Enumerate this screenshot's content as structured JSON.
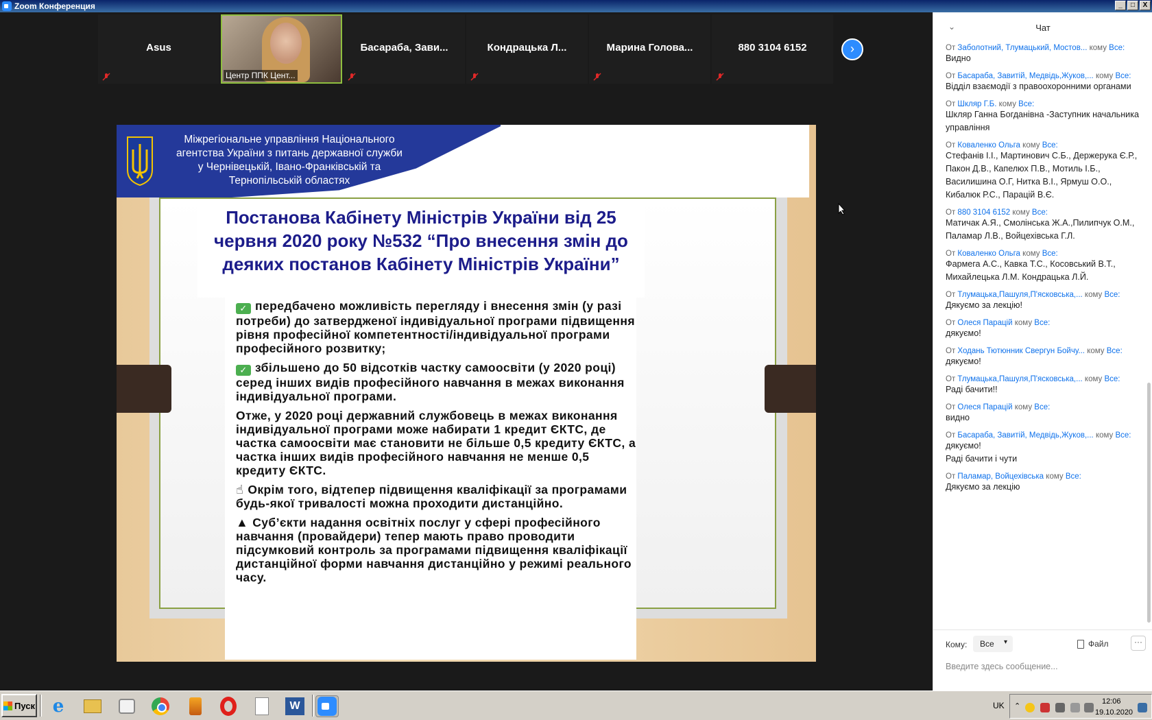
{
  "window": {
    "title": "Zoom Конференция",
    "buttons": [
      "_",
      "□",
      "X"
    ]
  },
  "gallery": {
    "tiles": [
      {
        "name": "Asus",
        "muted": true,
        "video": false
      },
      {
        "name": "",
        "label": "Центр ППК Цент...",
        "muted": false,
        "video": true
      },
      {
        "name": "Басараба,  Зави...",
        "muted": true,
        "video": false
      },
      {
        "name": "Кондрацька  Л...",
        "muted": true,
        "video": false
      },
      {
        "name": "Марина  Голова...",
        "muted": true,
        "video": false
      },
      {
        "name": "880 3104 6152",
        "muted": true,
        "video": false
      }
    ],
    "next_icon": "chevron-right-icon"
  },
  "slide": {
    "org_title": "Міжрегіональне управління Національного агентства України з питань державної служби  у Чернівецькій, Івано-Франківській та Тернопільській областях",
    "decree_title": "Постанова Кабінету Міністрів України від 25 червня 2020 року №532 “Про внесення змін до деяких постанов Кабінету Міністрів України”",
    "paragraphs": {
      "p1": "передбачено можливість перегляду і внесення змін (у разі потреби) до затвердженої індивідуальної програми підвищення рівня професійної компетентності/індивідуальної програми професійного розвитку;",
      "p2": "збільшено до 50 відсотків частку самоосвіти (у 2020 році) серед інших видів професійного навчання в межах виконання індивідуальної програми.",
      "p3": "Отже, у 2020 році державний службовець в межах виконання індивідуальної програми може набирати 1 кредит ЄКТС, де частка самоосвіти має становити не більше 0,5 кредиту ЄКТС, а частка інших видів професійного навчання не менше 0,5 кредиту ЄКТС.",
      "p4": "Окрім того, відтепер підвищення кваліфікації за програмами будь-якої тривалості можна проходити дистанційно.",
      "p5": "Суб’єкти надання освітніх послуг у сфері професійного навчання (провайдери) тепер мають право проводити підсумковий контроль за програмами підвищення кваліфікації дистанційної форми навчання дистанційно у режимі реального часу."
    },
    "check_mark": "✓"
  },
  "chat": {
    "title": "Чат",
    "messages": [
      {
        "from_label": "От",
        "sender": "Заболотний, Тлумацький, Мостов...",
        "to_label": "кому",
        "to": "Все:",
        "text": "Видно"
      },
      {
        "from_label": "От",
        "sender": "Басараба, Завитій, Медвідь,Жуков,...",
        "to_label": "кому",
        "to": "Все:",
        "text": "Відділ взаємодії з правоохоронними органами"
      },
      {
        "from_label": "От",
        "sender": "Шкляр Г.Б.",
        "to_label": "кому",
        "to": "Все:",
        "text": "Шкляр Ганна Богданівна -Заступник начальника управління"
      },
      {
        "from_label": "От",
        "sender": "Коваленко Ольга",
        "to_label": "кому",
        "to": "Все:",
        "text": "Стефанів І.І., Мартинович С.Б., Держерука Є.Р., Пакон Д.В., Капелюх П.В., Мотиль І.Б., Василишина О.Г, Нитка В.І., Ярмуш О.О., Кибалюк Р.С., Парацій В.Є."
      },
      {
        "from_label": "От",
        "sender": "880 3104 6152",
        "to_label": "кому",
        "to": "Все:",
        "text": "Матичак А.Я., Смолінська Ж.А.,Пилипчук О.М., Паламар Л.В., Войцехівська Г.Л."
      },
      {
        "from_label": "От",
        "sender": "Коваленко Ольга",
        "to_label": "кому",
        "to": "Все:",
        "text": "Фармега А.С., Кавка Т.С., Косовський В.Т., Михайлецька Л.М. Кондрацька Л.Й."
      },
      {
        "from_label": "От",
        "sender": "Тлумацька,Пашуля,П'ясковська,...",
        "to_label": "кому",
        "to": "Все:",
        "text": "Дякуємо за лекцію!"
      },
      {
        "from_label": "От",
        "sender": "Олеся Парацій",
        "to_label": "кому",
        "to": "Все:",
        "text": "дякуємо!"
      },
      {
        "from_label": "От",
        "sender": "Ходань Тютюнник Свергун  Бойчу...",
        "to_label": "кому",
        "to": "Все:",
        "text": "дякуємо!"
      },
      {
        "from_label": "От",
        "sender": "Тлумацька,Пашуля,П'ясковська,...",
        "to_label": "кому",
        "to": "Все:",
        "text": "Раді бачити!!"
      },
      {
        "from_label": "От",
        "sender": "Олеся Парацій",
        "to_label": "кому",
        "to": "Все:",
        "text": "видно"
      },
      {
        "from_label": "От",
        "sender": "Басараба, Завитій, Медвідь,Жуков,...",
        "to_label": "кому",
        "to": "Все:",
        "text": "дякуємо!\nРаді бачити і чути"
      },
      {
        "from_label": "От",
        "sender": "Паламар, Войцехівська",
        "to_label": "кому",
        "to": "Все:",
        "text": "Дякуємо за лекцію"
      }
    ],
    "to_label": "Кому:",
    "to_value": "Все",
    "file_label": "Файл",
    "more_label": "···",
    "input_placeholder": "Введите здесь сообщение..."
  },
  "taskbar": {
    "start_label": "Пуск",
    "lang": "UK",
    "time": "12:06",
    "date": "19.10.2020",
    "word_letter": "W",
    "ie_letter": "e"
  }
}
